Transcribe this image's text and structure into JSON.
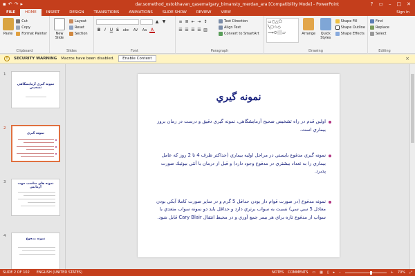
{
  "titlebar": {
    "title": "dar.somethod_ostokhavan_qasemalgary_bimansty_merdan_ara [Compatibility Mode] - PowerPoint",
    "qat": [
      "save-icon",
      "undo-icon",
      "redo-icon",
      "present-icon"
    ],
    "controls": [
      "?",
      "▭",
      "–",
      "□",
      "✕"
    ]
  },
  "tabs": {
    "file": "FILE",
    "items": [
      "HOME",
      "INSERT",
      "DESIGN",
      "TRANSITIONS",
      "ANIMATIONS",
      "SLIDE SHOW",
      "REVIEW",
      "VIEW"
    ],
    "active_index": 0,
    "signin": "Sign in"
  },
  "ribbon": {
    "clipboard": {
      "label": "Clipboard",
      "paste": "Paste",
      "cut": "Cut",
      "copy": "Copy",
      "format_painter": "Format Painter"
    },
    "slides": {
      "label": "Slides",
      "new_slide": "New Slide",
      "layout": "Layout",
      "reset": "Reset",
      "section": "Section"
    },
    "font": {
      "label": "Font",
      "font_name": "",
      "font_size": "",
      "bold": "B",
      "italic": "I",
      "underline": "U",
      "strike": "S",
      "shadow": "abc",
      "spacing": "AV",
      "case": "Aa",
      "color": "A"
    },
    "paragraph": {
      "label": "Paragraph",
      "text_direction": "Text Direction",
      "align_text": "Align Text",
      "convert_smartart": "Convert to SmartArt"
    },
    "drawing": {
      "label": "Drawing",
      "arrange": "Arrange",
      "quick_styles": "Quick Styles",
      "shape_fill": "Shape Fill",
      "shape_outline": "Shape Outline",
      "shape_effects": "Shape Effects"
    },
    "editing": {
      "label": "Editing",
      "find": "Find",
      "replace": "Replace",
      "select": "Select"
    }
  },
  "security": {
    "title": "SECURITY WARNING",
    "message": "Macros have been disabled.",
    "button": "Enable Content"
  },
  "thumbnails": [
    {
      "num": "1",
      "title": "نمونه گيري آزمايشگاهي تشخيص",
      "active": false
    },
    {
      "num": "2",
      "title": "نمونه گيري",
      "active": true
    },
    {
      "num": "3",
      "title": "نمونه هاي مناسب جهت آزمايش",
      "active": false
    },
    {
      "num": "4",
      "title": "نمونه مدفوع",
      "active": false
    }
  ],
  "slide": {
    "title": "نمونه گيري",
    "bullets": [
      "اولين قدم در راه تشخيص صحيح آزمايشگاهي، نمونه گيري دقيق و درست در زمان بروز بيماري است.",
      "نمونه گيري مدفوع بايستي در مراحل اوليه بيماري (حداكثر ظرف 4 تا 2 روز كه عامل بيماري زا به تعداد بيشتري در مدفوع وجود دارد) و قبل از درمان با آنتي بيوتيك صورت پذيرد.",
      "نمونه مدفوع (در صورت قوام دار بودن حداقل 5 گرم و در ساير صورت كاملا آبكي بودن معادل 5 سي سي) نسبت به سواب برتري دارد و حداقل بايد دو نمونه سواب متعدي با سواب از مدفوع تازه براي هر بيمر جمع آوري و در محيط انتقال Cary Blair قابل شود."
    ]
  },
  "status": {
    "slide_info": "SLIDE 2 OF 102",
    "language": "ENGLISH (UNITED STATES)",
    "notes": "NOTES",
    "comments": "COMMENTS",
    "zoom": "70%"
  },
  "colors": {
    "accent": "#c43e1c",
    "title_text": "#1a237e",
    "bullet": "#b03080"
  }
}
